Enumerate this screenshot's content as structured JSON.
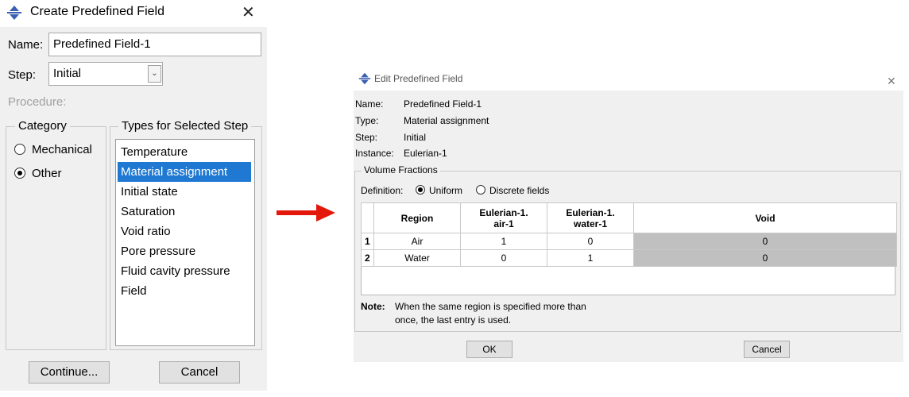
{
  "left_dialog": {
    "title": "Create Predefined Field",
    "name_label": "Name:",
    "name_value": "Predefined Field-1",
    "step_label": "Step:",
    "step_value": "Initial",
    "procedure_label": "Procedure:",
    "category_legend": "Category",
    "categories": [
      {
        "label": "Mechanical",
        "selected": false
      },
      {
        "label": "Other",
        "selected": true
      }
    ],
    "types_legend": "Types for Selected Step",
    "types": [
      {
        "label": "Temperature",
        "selected": false
      },
      {
        "label": "Material assignment",
        "selected": true
      },
      {
        "label": "Initial state",
        "selected": false
      },
      {
        "label": "Saturation",
        "selected": false
      },
      {
        "label": "Void ratio",
        "selected": false
      },
      {
        "label": "Pore pressure",
        "selected": false
      },
      {
        "label": "Fluid cavity pressure",
        "selected": false
      },
      {
        "label": "Field",
        "selected": false
      }
    ],
    "continue_label": "Continue...",
    "cancel_label": "Cancel"
  },
  "right_dialog": {
    "title": "Edit Predefined Field",
    "info": [
      {
        "label": "Name:",
        "value": "Predefined Field-1"
      },
      {
        "label": "Type:",
        "value": "Material assignment"
      },
      {
        "label": "Step:",
        "value": "Initial"
      },
      {
        "label": "Instance:",
        "value": "Eulerian-1"
      }
    ],
    "volume_legend": "Volume Fractions",
    "definition_label": "Definition:",
    "definition_options": [
      {
        "label": "Uniform",
        "selected": true
      },
      {
        "label": "Discrete fields",
        "selected": false
      }
    ],
    "table": {
      "headers": [
        "Region",
        "Eulerian-1.\nair-1",
        "Eulerian-1.\nwater-1",
        "Void"
      ],
      "rows": [
        {
          "index": "1",
          "cells": [
            "Air",
            "1",
            "0",
            "0"
          ]
        },
        {
          "index": "2",
          "cells": [
            "Water",
            "0",
            "1",
            "0"
          ]
        }
      ]
    },
    "note_label": "Note:",
    "note_text_line1": "When the same region is specified more than",
    "note_text_line2": "once, the last entry is used.",
    "ok_label": "OK",
    "cancel_label": "Cancel"
  },
  "colors": {
    "selection": "#1f78d1",
    "arrow": "#e3170a",
    "void_cell": "#c0c0c0",
    "dialog_bg": "#f0f0f0"
  },
  "icons": [
    "abaqus-app-icon",
    "close-icon",
    "chevron-down-icon",
    "right-arrow-icon"
  ]
}
